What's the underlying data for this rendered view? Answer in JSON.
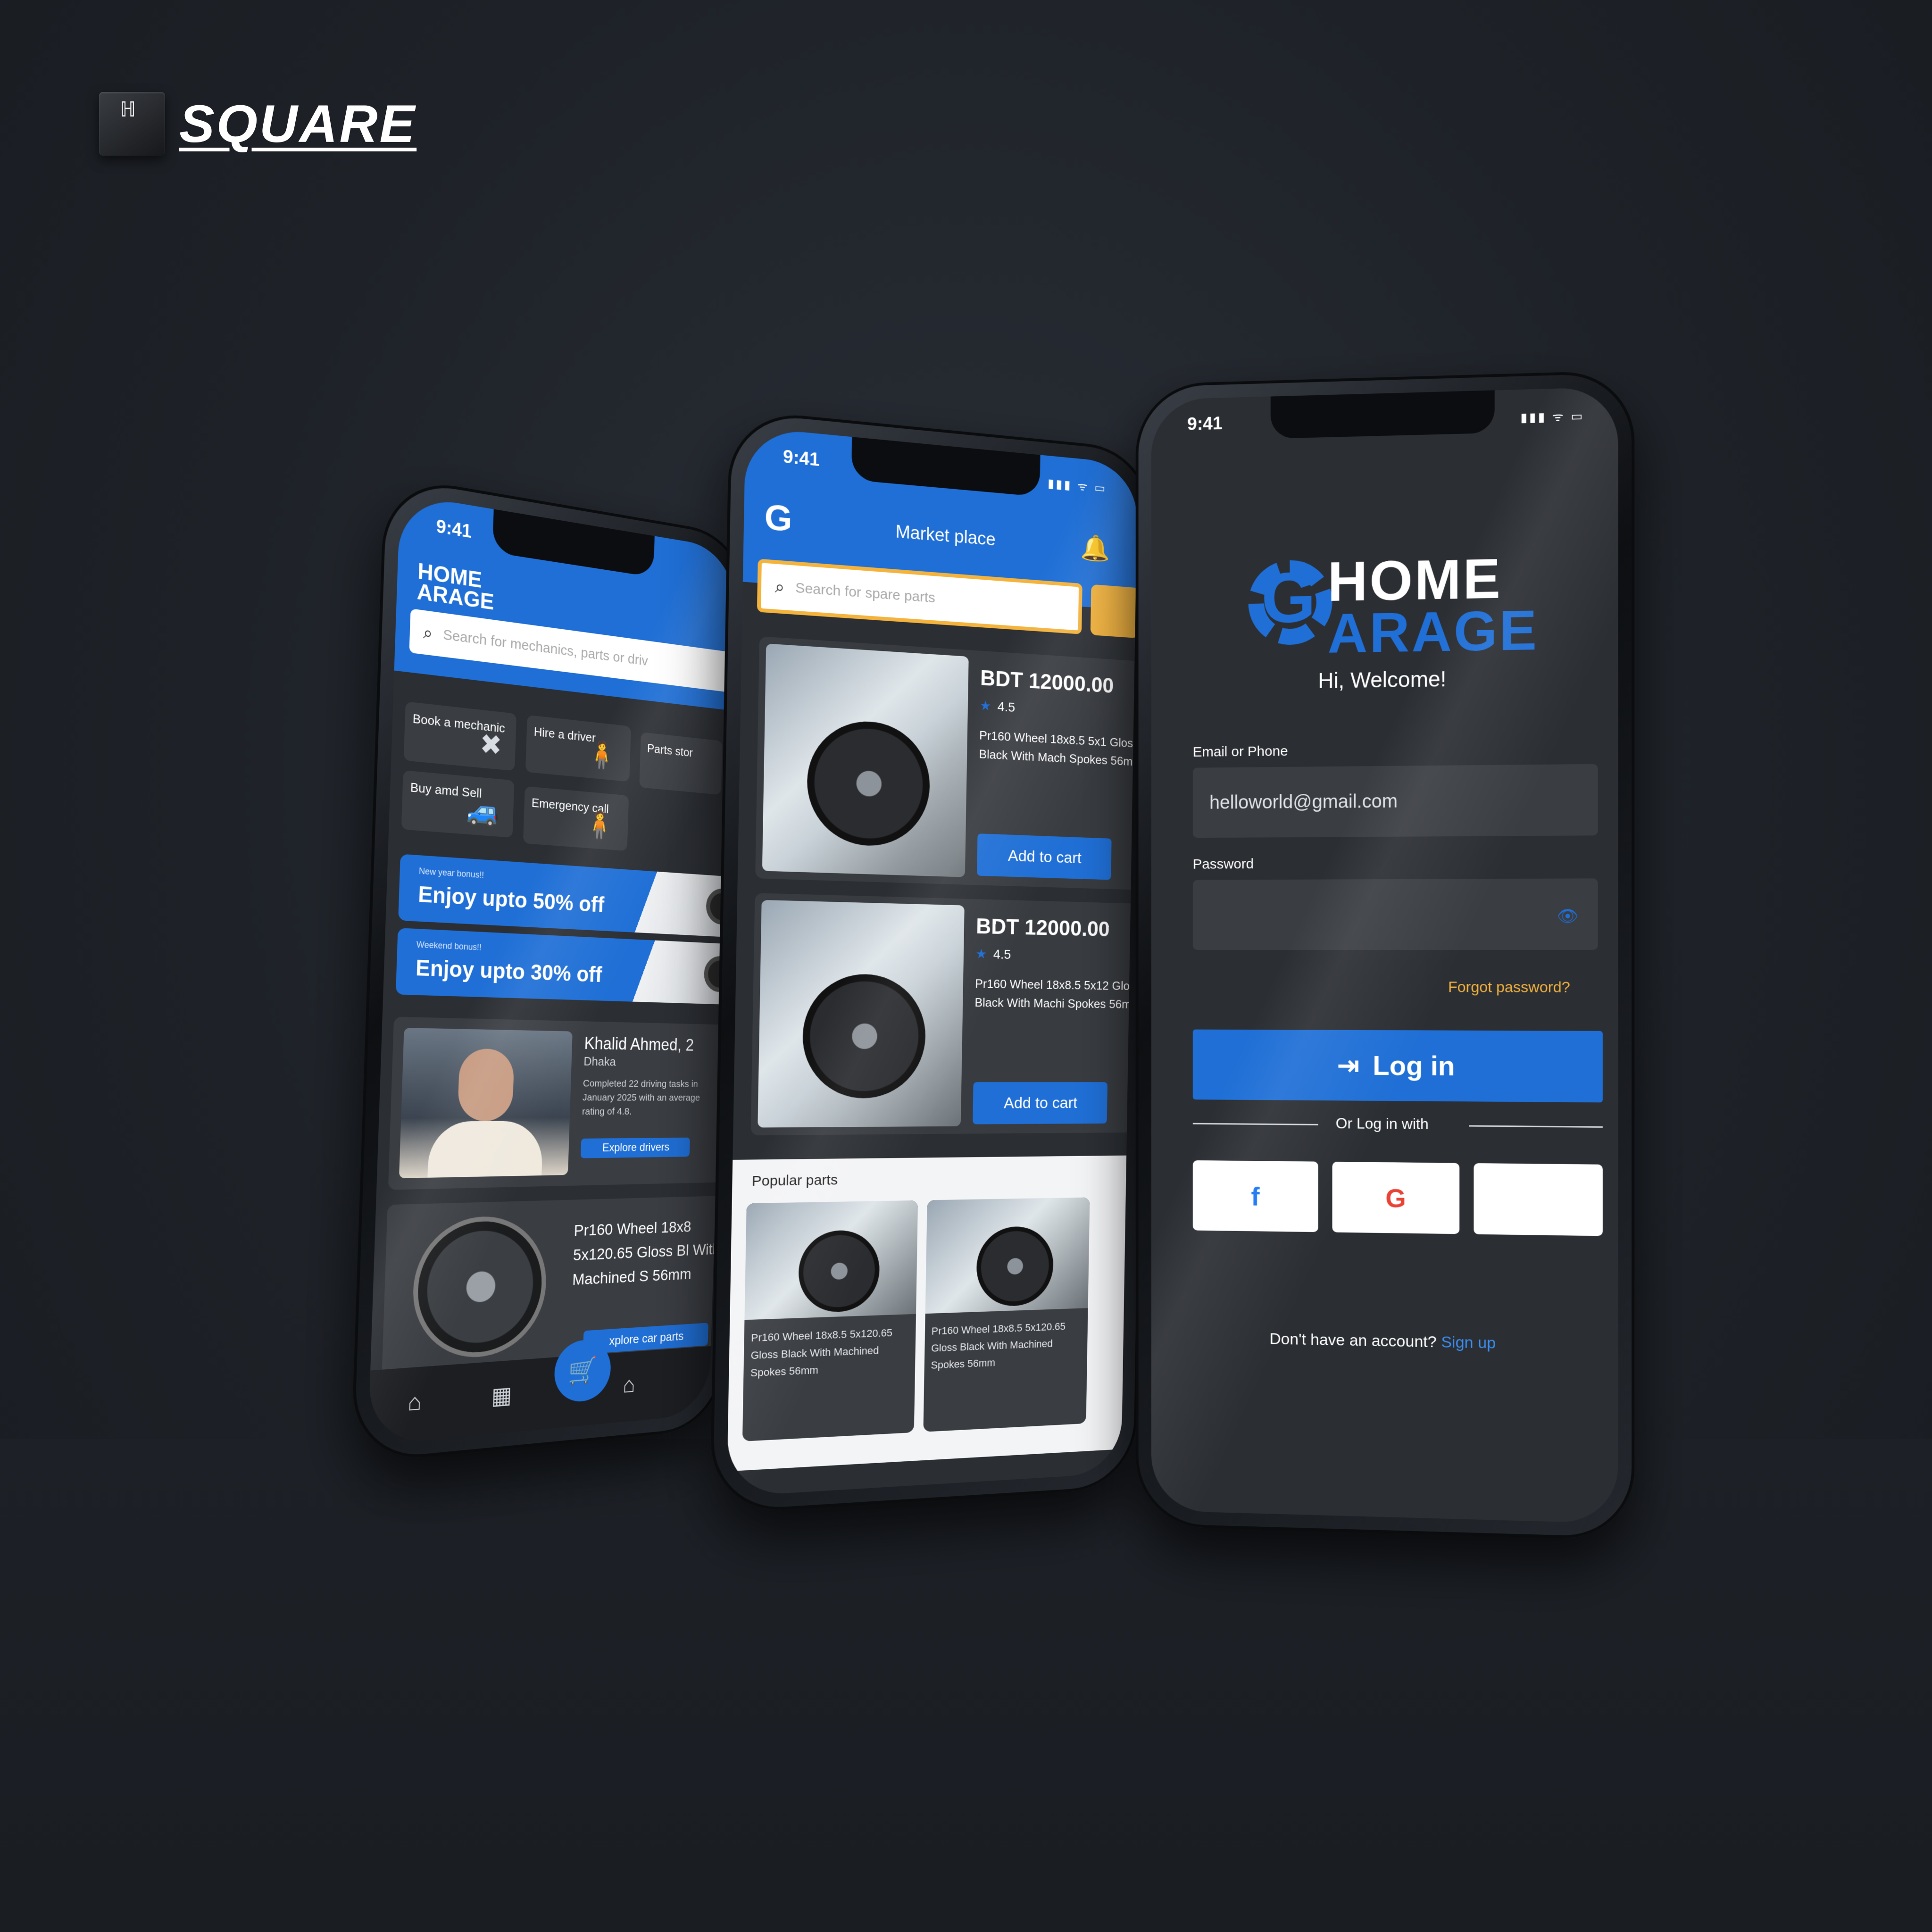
{
  "brand": {
    "key_glyph": "ℍ",
    "name": "SQUARE"
  },
  "status": {
    "time": "9:41",
    "signal": "▮▮▮ ᯤ ▭"
  },
  "home_screen": {
    "logo_line1": "HOME",
    "logo_line2": "ARAGE",
    "search_placeholder": "Search for mechanics, parts or driv",
    "tiles": [
      {
        "label": "Book a mechanic",
        "icon": "wrench-icon",
        "glyph": "✖"
      },
      {
        "label": "Hire a driver",
        "icon": "driver-icon",
        "glyph": "🧍"
      },
      {
        "label": "Parts stor",
        "icon": "store-icon",
        "glyph": ""
      },
      {
        "label": "Buy amd Sell",
        "icon": "car-icon",
        "glyph": "🚙"
      },
      {
        "label": "Emergency call",
        "icon": "person-icon",
        "glyph": "🧍"
      }
    ],
    "promos": [
      {
        "sub": "New year bonus!!",
        "main": "Enjoy upto 50% off"
      },
      {
        "sub": "Weekend bonus!!",
        "main": "Enjoy upto 30% off"
      }
    ],
    "driver": {
      "name": "Khalid Ahmed, 2",
      "location": "Dhaka",
      "description": "Completed 22 driving tasks in January 2025 with an average rating of 4.8.",
      "button": "Explore drivers"
    },
    "part": {
      "text": "Pr160 Wheel 18x8 5x120.65 Gloss Bl With Machined S 56mm",
      "button": "xplore car parts"
    },
    "fab_glyph": "🛒",
    "tabs": [
      {
        "icon": "home-icon",
        "glyph": "⌂"
      },
      {
        "icon": "calendar-icon",
        "glyph": "▦"
      },
      {
        "icon": "garage-icon",
        "glyph": "⌂"
      }
    ]
  },
  "market_screen": {
    "logo_glyph": "G",
    "title": "Market place",
    "bell_glyph": "🔔",
    "search_placeholder": "Search for spare parts",
    "products": [
      {
        "price": "BDT 12000.00",
        "rating": "4.5",
        "desc": "Pr160 Wheel 18x8.5 5x1 Gloss Black With Mach Spokes 56mm",
        "button": "Add to cart"
      },
      {
        "price": "BDT 12000.00",
        "rating": "4.5",
        "desc": "Pr160 Wheel 18x8.5 5x12 Gloss Black With Machi Spokes 56mm",
        "button": "Add to cart"
      }
    ],
    "popular_title": "Popular parts",
    "popular": [
      {
        "desc": "Pr160 Wheel 18x8.5 5x120.65 Gloss Black With Machined Spokes 56mm"
      },
      {
        "desc": "Pr160 Wheel 18x8.5 5x120.65 Gloss Black With Machined Spokes 56mm"
      }
    ]
  },
  "login_screen": {
    "logo_line1": "HOME",
    "logo_line2": "ARAGE",
    "logo_g": "G",
    "welcome": "Hi, Welcome!",
    "email_label": "Email or Phone",
    "email_value": "helloworld@gmail.com",
    "password_label": "Password",
    "password_value": "",
    "eye_glyph": "👁",
    "forgot": "Forgot password?",
    "login_icon": "⇥",
    "login_label": "Log in",
    "divider_text": "Or Log in with",
    "social": [
      {
        "name": "facebook-icon",
        "glyph": "f",
        "color": "#1877f2"
      },
      {
        "name": "google-icon",
        "glyph": "G",
        "color": "#ea4335"
      },
      {
        "name": "apple-icon",
        "glyph": "",
        "color": "#000000"
      }
    ],
    "signup_prompt": "Don't have an account?",
    "signup_link": "Sign up"
  },
  "colors": {
    "accent": "#1f6fd6",
    "warning": "#f3b33d",
    "surface": "#3a3d42",
    "background": "#1e2228"
  }
}
